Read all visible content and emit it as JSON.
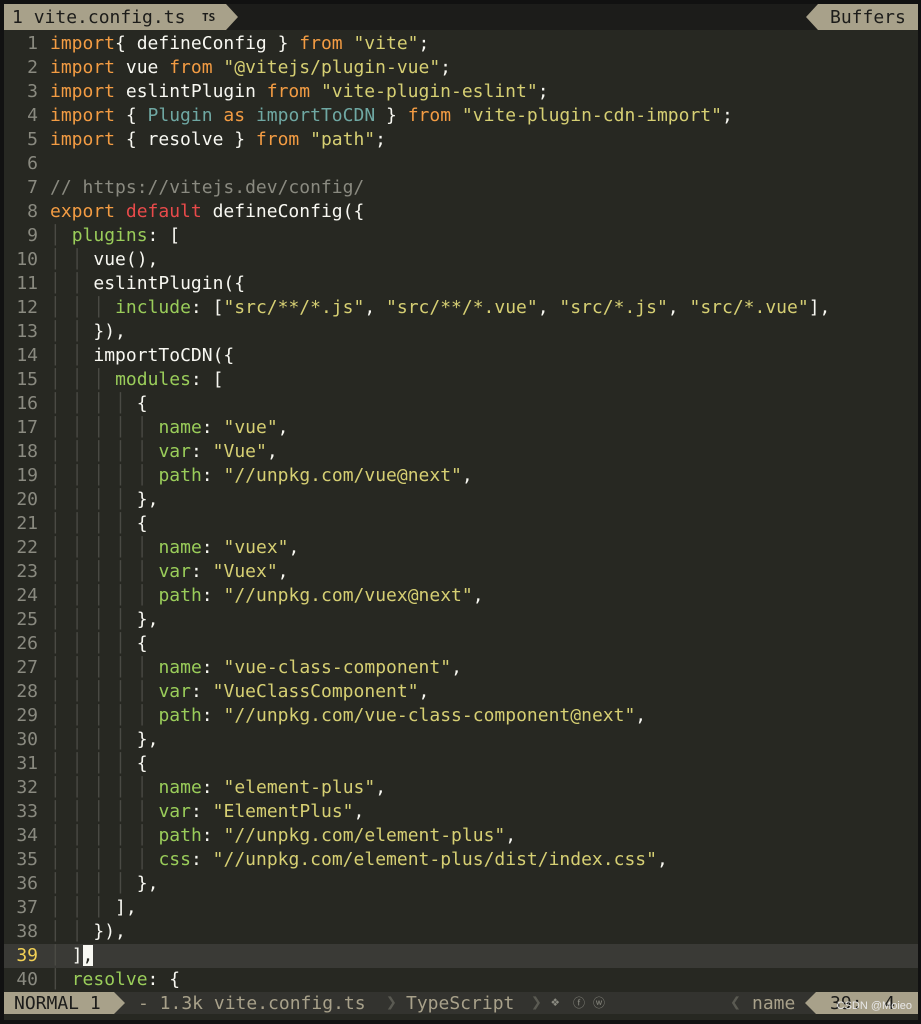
{
  "tabline": {
    "tab_number": "1",
    "tab_filename": "vite.config.ts",
    "tab_icon": "TS",
    "buffers_label": "Buffers"
  },
  "editor": {
    "current_line": 39,
    "lines": [
      {
        "n": "1",
        "indent": 0,
        "tokens": [
          [
            "kw",
            "import"
          ],
          [
            "",
            "{ defineConfig } "
          ],
          [
            "kw",
            "from"
          ],
          [
            "",
            " "
          ],
          [
            "str",
            "\"vite\""
          ],
          [
            "",
            ";"
          ]
        ]
      },
      {
        "n": "2",
        "indent": 0,
        "tokens": [
          [
            "kw",
            "import"
          ],
          [
            "",
            " vue "
          ],
          [
            "kw",
            "from"
          ],
          [
            "",
            " "
          ],
          [
            "str",
            "\"@vitejs/plugin-vue\""
          ],
          [
            "",
            ";"
          ]
        ]
      },
      {
        "n": "3",
        "indent": 0,
        "tokens": [
          [
            "kw",
            "import"
          ],
          [
            "",
            " eslintPlugin "
          ],
          [
            "kw",
            "from"
          ],
          [
            "",
            " "
          ],
          [
            "str",
            "\"vite-plugin-eslint\""
          ],
          [
            "",
            ";"
          ]
        ]
      },
      {
        "n": "4",
        "indent": 0,
        "tokens": [
          [
            "kw",
            "import"
          ],
          [
            "",
            " { "
          ],
          [
            "cls",
            "Plugin"
          ],
          [
            "",
            " "
          ],
          [
            "kw",
            "as"
          ],
          [
            "",
            " "
          ],
          [
            "cls",
            "importToCDN"
          ],
          [
            "",
            " } "
          ],
          [
            "kw",
            "from"
          ],
          [
            "",
            " "
          ],
          [
            "str",
            "\"vite-plugin-cdn-import\""
          ],
          [
            "",
            ";"
          ]
        ]
      },
      {
        "n": "5",
        "indent": 0,
        "tokens": [
          [
            "kw",
            "import"
          ],
          [
            "",
            " { resolve } "
          ],
          [
            "kw",
            "from"
          ],
          [
            "",
            " "
          ],
          [
            "str",
            "\"path\""
          ],
          [
            "",
            ";"
          ]
        ]
      },
      {
        "n": "6",
        "indent": 0,
        "tokens": []
      },
      {
        "n": "7",
        "indent": 0,
        "tokens": [
          [
            "cmt",
            "// https://vitejs.dev/config/"
          ]
        ]
      },
      {
        "n": "8",
        "indent": 0,
        "tokens": [
          [
            "kw",
            "export"
          ],
          [
            "",
            " "
          ],
          [
            "kw2",
            "default"
          ],
          [
            "",
            " defineConfig({"
          ]
        ]
      },
      {
        "n": "9",
        "indent": 1,
        "tokens": [
          [
            "prop",
            "plugins"
          ],
          [
            "",
            ": ["
          ]
        ]
      },
      {
        "n": "10",
        "indent": 2,
        "tokens": [
          [
            "",
            "vue(),"
          ]
        ]
      },
      {
        "n": "11",
        "indent": 2,
        "tokens": [
          [
            "",
            "eslintPlugin({"
          ]
        ]
      },
      {
        "n": "12",
        "indent": 3,
        "tokens": [
          [
            "prop",
            "include"
          ],
          [
            "",
            ": ["
          ],
          [
            "str",
            "\"src/**/*.js\""
          ],
          [
            "",
            ", "
          ],
          [
            "str",
            "\"src/**/*.vue\""
          ],
          [
            "",
            ", "
          ],
          [
            "str",
            "\"src/*.js\""
          ],
          [
            "",
            ", "
          ],
          [
            "str",
            "\"src/*.vue\""
          ],
          [
            "",
            "],"
          ]
        ]
      },
      {
        "n": "13",
        "indent": 2,
        "tokens": [
          [
            "",
            "}),"
          ]
        ]
      },
      {
        "n": "14",
        "indent": 2,
        "tokens": [
          [
            "",
            "importToCDN({"
          ]
        ]
      },
      {
        "n": "15",
        "indent": 3,
        "tokens": [
          [
            "prop",
            "modules"
          ],
          [
            "",
            ": ["
          ]
        ]
      },
      {
        "n": "16",
        "indent": 4,
        "tokens": [
          [
            "",
            "{"
          ]
        ]
      },
      {
        "n": "17",
        "indent": 5,
        "tokens": [
          [
            "prop",
            "name"
          ],
          [
            "",
            ": "
          ],
          [
            "str",
            "\"vue\""
          ],
          [
            "",
            ","
          ]
        ]
      },
      {
        "n": "18",
        "indent": 5,
        "tokens": [
          [
            "prop",
            "var"
          ],
          [
            "",
            ": "
          ],
          [
            "str",
            "\"Vue\""
          ],
          [
            "",
            ","
          ]
        ]
      },
      {
        "n": "19",
        "indent": 5,
        "tokens": [
          [
            "prop",
            "path"
          ],
          [
            "",
            ": "
          ],
          [
            "str",
            "\"//unpkg.com/vue@next\""
          ],
          [
            "",
            ","
          ]
        ]
      },
      {
        "n": "20",
        "indent": 4,
        "tokens": [
          [
            "",
            "},"
          ]
        ]
      },
      {
        "n": "21",
        "indent": 4,
        "tokens": [
          [
            "",
            "{"
          ]
        ]
      },
      {
        "n": "22",
        "indent": 5,
        "tokens": [
          [
            "prop",
            "name"
          ],
          [
            "",
            ": "
          ],
          [
            "str",
            "\"vuex\""
          ],
          [
            "",
            ","
          ]
        ]
      },
      {
        "n": "23",
        "indent": 5,
        "tokens": [
          [
            "prop",
            "var"
          ],
          [
            "",
            ": "
          ],
          [
            "str",
            "\"Vuex\""
          ],
          [
            "",
            ","
          ]
        ]
      },
      {
        "n": "24",
        "indent": 5,
        "tokens": [
          [
            "prop",
            "path"
          ],
          [
            "",
            ": "
          ],
          [
            "str",
            "\"//unpkg.com/vuex@next\""
          ],
          [
            "",
            ","
          ]
        ]
      },
      {
        "n": "25",
        "indent": 4,
        "tokens": [
          [
            "",
            "},"
          ]
        ]
      },
      {
        "n": "26",
        "indent": 4,
        "tokens": [
          [
            "",
            "{"
          ]
        ]
      },
      {
        "n": "27",
        "indent": 5,
        "tokens": [
          [
            "prop",
            "name"
          ],
          [
            "",
            ": "
          ],
          [
            "str",
            "\"vue-class-component\""
          ],
          [
            "",
            ","
          ]
        ]
      },
      {
        "n": "28",
        "indent": 5,
        "tokens": [
          [
            "prop",
            "var"
          ],
          [
            "",
            ": "
          ],
          [
            "str",
            "\"VueClassComponent\""
          ],
          [
            "",
            ","
          ]
        ]
      },
      {
        "n": "29",
        "indent": 5,
        "tokens": [
          [
            "prop",
            "path"
          ],
          [
            "",
            ": "
          ],
          [
            "str",
            "\"//unpkg.com/vue-class-component@next\""
          ],
          [
            "",
            ","
          ]
        ]
      },
      {
        "n": "30",
        "indent": 4,
        "tokens": [
          [
            "",
            "},"
          ]
        ]
      },
      {
        "n": "31",
        "indent": 4,
        "tokens": [
          [
            "",
            "{"
          ]
        ]
      },
      {
        "n": "32",
        "indent": 5,
        "tokens": [
          [
            "prop",
            "name"
          ],
          [
            "",
            ": "
          ],
          [
            "str",
            "\"element-plus\""
          ],
          [
            "",
            ","
          ]
        ]
      },
      {
        "n": "33",
        "indent": 5,
        "tokens": [
          [
            "prop",
            "var"
          ],
          [
            "",
            ": "
          ],
          [
            "str",
            "\"ElementPlus\""
          ],
          [
            "",
            ","
          ]
        ]
      },
      {
        "n": "34",
        "indent": 5,
        "tokens": [
          [
            "prop",
            "path"
          ],
          [
            "",
            ": "
          ],
          [
            "str",
            "\"//unpkg.com/element-plus\""
          ],
          [
            "",
            ","
          ]
        ]
      },
      {
        "n": "35",
        "indent": 5,
        "tokens": [
          [
            "prop",
            "css"
          ],
          [
            "",
            ": "
          ],
          [
            "str",
            "\"//unpkg.com/element-plus/dist/index.css\""
          ],
          [
            "",
            ","
          ]
        ]
      },
      {
        "n": "36",
        "indent": 4,
        "tokens": [
          [
            "",
            "},"
          ]
        ]
      },
      {
        "n": "37",
        "indent": 3,
        "tokens": [
          [
            "",
            "],"
          ]
        ]
      },
      {
        "n": "38",
        "indent": 2,
        "tokens": [
          [
            "",
            "}),"
          ]
        ]
      },
      {
        "n": "39",
        "indent": 1,
        "tokens": [
          [
            "",
            "]"
          ],
          [
            "cursor",
            ","
          ]
        ]
      },
      {
        "n": "40",
        "indent": 1,
        "tokens": [
          [
            "prop",
            "resolve"
          ],
          [
            "",
            ": {"
          ]
        ]
      }
    ]
  },
  "statusline": {
    "mode": "NORMAL 1",
    "fileinfo": "- 1.3k vite.config.ts",
    "filetype": "TypeScript",
    "symbols": [
      "❖",
      "ⓕ",
      "ⓦ"
    ],
    "section": "name",
    "position": "39:  4"
  },
  "watermark": "CSDN @Moieo"
}
